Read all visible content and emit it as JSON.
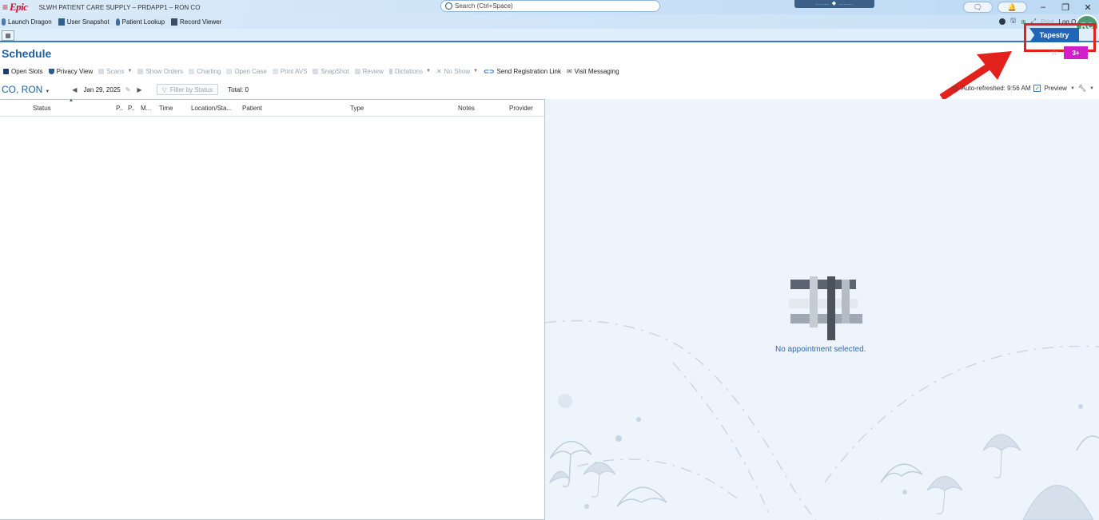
{
  "titlebar": {
    "logo": "Epic",
    "environment": "SLWH PATIENT CARE SUPPLY – PRDAPP1 – RON CO",
    "search_placeholder": "Search (Ctrl+Space)",
    "center_pill": "...... ◆ ......"
  },
  "activity_bar": {
    "items": [
      "Launch Dragon",
      "User Snapshot",
      "Patient Lookup",
      "Record Viewer"
    ],
    "right_print": "Print",
    "right_logout": "Log Out",
    "avatar": "RC"
  },
  "tabs": {
    "tapestry": "Tapestry",
    "badge": "3+"
  },
  "page": {
    "title": "Schedule"
  },
  "toolbar": {
    "buttons": [
      {
        "label": "Open Slots",
        "dim": false
      },
      {
        "label": "Privacy View",
        "dim": false
      },
      {
        "label": "Scans",
        "dim": true
      },
      {
        "label": "Show Orders",
        "dim": true
      },
      {
        "label": "Charting",
        "dim": true
      },
      {
        "label": "Open Case",
        "dim": true
      },
      {
        "label": "Print AVS",
        "dim": true
      },
      {
        "label": "SnapShot",
        "dim": true
      },
      {
        "label": "Review",
        "dim": true
      },
      {
        "label": "Dictations",
        "dim": true
      },
      {
        "label": "No Show",
        "dim": true
      },
      {
        "label": "Send Registration Link",
        "dim": false
      },
      {
        "label": "Visit Messaging",
        "dim": false
      }
    ]
  },
  "schedule": {
    "provider": "CO, RON",
    "date": "Jan 29, 2025",
    "filter_label": "Filter by Status",
    "total": "Total: 0",
    "auto_refresh": "Auto-refreshed: 9:56 AM",
    "preview_label": "Preview",
    "columns": [
      "Status",
      "P..",
      "P..",
      "M...",
      "Time",
      "Location/Sta...",
      "Patient",
      "Type",
      "Notes",
      "Provider"
    ]
  },
  "detail": {
    "empty_message": "No appointment selected."
  },
  "colors": {
    "epic_red": "#c8102e",
    "accent_blue": "#1a5fa8",
    "tapestry_blue": "#1e67b8",
    "highlight_red": "#e3211c",
    "badge_magenta": "#d220c8"
  }
}
